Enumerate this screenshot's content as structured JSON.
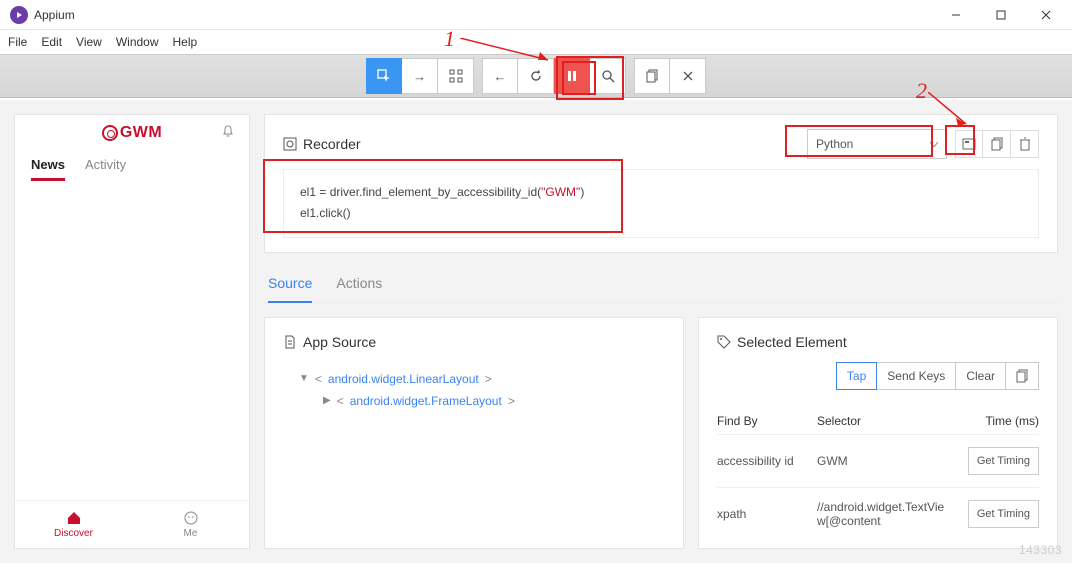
{
  "window": {
    "title": "Appium"
  },
  "menu": [
    "File",
    "Edit",
    "View",
    "Window",
    "Help"
  ],
  "annotations": {
    "one": "1",
    "two": "2"
  },
  "recorder": {
    "title": "Recorder",
    "language": "Python",
    "code_l1a": "el1 = driver.find_element_by_accessibility_id(",
    "code_l1b": "\"GWM\"",
    "code_l1c": ")",
    "code_l2": "el1.click()"
  },
  "phone": {
    "brand": "GWM",
    "tabs": {
      "news": "News",
      "activity": "Activity"
    },
    "nav": {
      "discover": "Discover",
      "me": "Me"
    }
  },
  "inspector": {
    "tabs": {
      "source": "Source",
      "actions": "Actions"
    },
    "app_source_title": "App Source",
    "tree": {
      "n1": "android.widget.LinearLayout",
      "n2": "android.widget.FrameLayout"
    },
    "selected": {
      "title": "Selected Element",
      "actions": {
        "tap": "Tap",
        "send": "Send Keys",
        "clear": "Clear"
      },
      "headers": {
        "find": "Find By",
        "selector": "Selector",
        "time": "Time (ms)"
      },
      "rows": [
        {
          "find": "accessibility id",
          "selector": "GWM",
          "btn": "Get Timing"
        },
        {
          "find": "xpath",
          "selector": "//android.widget.TextView[@content",
          "btn": "Get Timing"
        }
      ]
    }
  },
  "watermark": "143303"
}
